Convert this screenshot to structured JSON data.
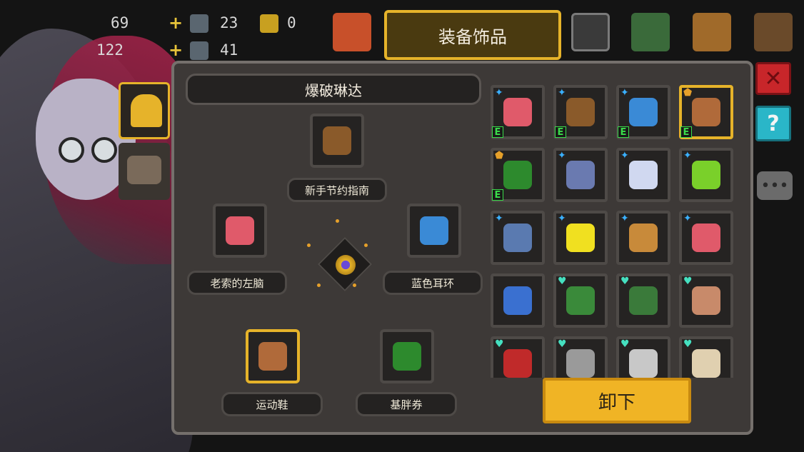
{
  "topbar": {
    "stat1": "69",
    "stat2": "122",
    "res1": "23",
    "res2": "41",
    "res3": "0",
    "tab_title": "装备饰品"
  },
  "panel": {
    "character_name": "爆破琳达",
    "slots": {
      "top": "新手节约指南",
      "left": "老索的左脑",
      "right": "蓝色耳环",
      "bottom_left": "运动鞋",
      "bottom_right": "基胖券"
    },
    "unequip_label": "卸下"
  },
  "grid_items": [
    {
      "corner": "star",
      "badge": "E",
      "color": "#e05a6a",
      "icon": "brain-icon"
    },
    {
      "corner": "star",
      "badge": "E",
      "color": "#8a5a2a",
      "icon": "book-icon"
    },
    {
      "corner": "star",
      "badge": "E",
      "color": "#3a8ad6",
      "icon": "earring-icon"
    },
    {
      "corner": "shield",
      "badge": "E",
      "color": "#b06a3a",
      "icon": "shoe-icon",
      "selected": true
    },
    {
      "corner": "shield",
      "badge": "E",
      "color": "#2d8a2d",
      "icon": "coupon-icon"
    },
    {
      "corner": "star",
      "badge": "",
      "color": "#6a7ab0",
      "icon": "amulet-icon"
    },
    {
      "corner": "star",
      "badge": "",
      "color": "#d0d8f0",
      "icon": "necklace-icon"
    },
    {
      "corner": "star",
      "badge": "",
      "color": "#7ad02a",
      "icon": "potion-icon"
    },
    {
      "corner": "star",
      "badge": "",
      "color": "#5a7ab0",
      "icon": "ring-icon"
    },
    {
      "corner": "star",
      "badge": "",
      "color": "#f0e020",
      "icon": "star-icon"
    },
    {
      "corner": "star",
      "badge": "",
      "color": "#c88a3a",
      "icon": "medal-icon"
    },
    {
      "corner": "star",
      "badge": "",
      "color": "#e05a6a",
      "icon": "brain-icon"
    },
    {
      "corner": "none",
      "badge": "",
      "color": "#3a70d0",
      "icon": "flashlight-icon"
    },
    {
      "corner": "heart",
      "badge": "",
      "color": "#3a8a3a",
      "icon": "clover-icon"
    },
    {
      "corner": "heart",
      "badge": "",
      "color": "#3a7a3a",
      "icon": "pot-icon"
    },
    {
      "corner": "heart",
      "badge": "",
      "color": "#c88a6a",
      "icon": "face-icon"
    },
    {
      "corner": "heart",
      "badge": "",
      "color": "#c02a2a",
      "icon": "mallet-icon"
    },
    {
      "corner": "heart",
      "badge": "",
      "color": "#9a9a9a",
      "icon": "helmet-icon"
    },
    {
      "corner": "heart",
      "badge": "",
      "color": "#c8c8c8",
      "icon": "ghost-icon"
    },
    {
      "corner": "heart",
      "badge": "",
      "color": "#e0d0b0",
      "icon": "bone-icon"
    }
  ],
  "colors": {
    "accent": "#e6b32a",
    "panel": "#3d3937",
    "button": "#f0b425"
  }
}
